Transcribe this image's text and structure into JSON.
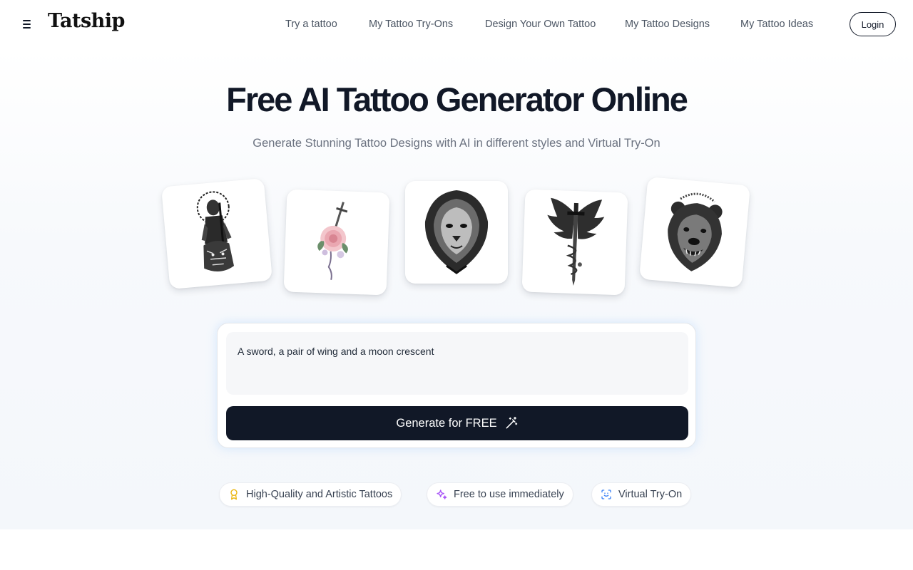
{
  "header": {
    "logo": "Tatship",
    "menu_icon": "hamburger-menu-icon",
    "nav": [
      {
        "label": "Try a tattoo"
      },
      {
        "label": "My Tattoo Try-Ons"
      },
      {
        "label": "Design Your Own Tattoo"
      },
      {
        "label": "My Tattoo Designs"
      },
      {
        "label": "My Tattoo Ideas"
      }
    ],
    "login_label": "Login"
  },
  "hero": {
    "title": "Free AI Tattoo Generator Online",
    "subtitle": "Generate Stunning Tattoo Designs with AI in different styles and Virtual Try-On"
  },
  "gallery": [
    {
      "icon": "knight-tiger-tattoo-image"
    },
    {
      "icon": "rose-dagger-tattoo-image"
    },
    {
      "icon": "lion-tattoo-image"
    },
    {
      "icon": "winged-sword-tattoo-image"
    },
    {
      "icon": "bear-tattoo-image"
    }
  ],
  "prompt": {
    "value": "A sword, a pair of wing and a moon crescent",
    "button_label": "Generate for FREE",
    "button_icon": "magic-wand-icon"
  },
  "features": [
    {
      "label": "High-Quality and Artistic Tattoos",
      "icon": "award-icon",
      "color": "#eab308"
    },
    {
      "label": "Free to use immediately",
      "icon": "sparkles-icon",
      "color": "#a855f7"
    },
    {
      "label": "Virtual Try-On",
      "icon": "scan-face-icon",
      "color": "#3b82f6"
    }
  ],
  "colors": {
    "primary": "#111827",
    "text_muted": "#6b7280",
    "background": "#ffffff"
  }
}
